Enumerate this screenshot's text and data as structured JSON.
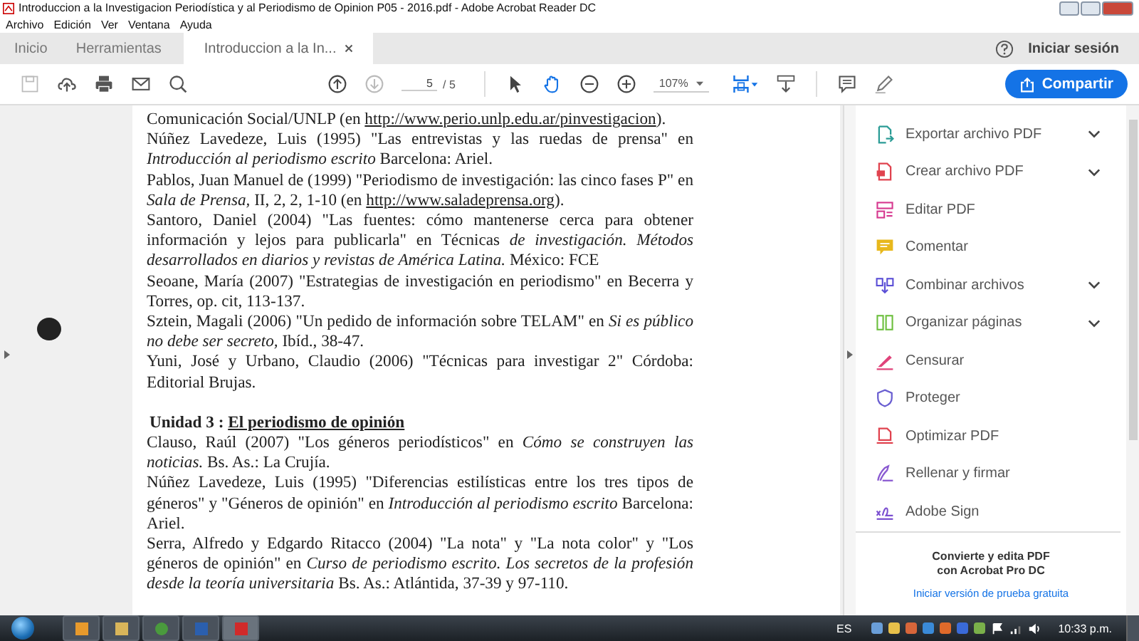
{
  "window": {
    "title": "Introduccion a la Investigacion Periodística y al Periodismo de Opinion P05 - 2016.pdf - Adobe Acrobat Reader DC"
  },
  "menu": [
    "Archivo",
    "Edición",
    "Ver",
    "Ventana",
    "Ayuda"
  ],
  "tabs": [
    {
      "label": "Inicio",
      "selected": false,
      "closable": false
    },
    {
      "label": "Herramientas",
      "selected": false,
      "closable": false
    },
    {
      "label": "Introduccion a la In...",
      "selected": true,
      "closable": true
    }
  ],
  "account": {
    "label": "Iniciar sesión"
  },
  "toolbar": {
    "page_current": "5",
    "page_total": "/ 5",
    "zoom": "107%",
    "share": "Compartir"
  },
  "document": {
    "references_top": [
      {
        "segments": [
          {
            "kind": "text",
            "text": "Comunicación Social/UNLP (en "
          },
          {
            "kind": "link",
            "text": "http://www.perio.unlp.edu.ar/pinvestigacion"
          },
          {
            "kind": "text",
            "text": ")."
          }
        ]
      },
      {
        "segments": [
          {
            "kind": "text",
            "text": "Núñez Lavedeze, Luis (1995) \"Las entrevistas y las ruedas de prensa\" en "
          },
          {
            "kind": "italic",
            "text": "Introducción al periodismo escrito"
          },
          {
            "kind": "text",
            "text": "  Barcelona: Ariel."
          }
        ]
      },
      {
        "segments": [
          {
            "kind": "text",
            "text": "Pablos, Juan Manuel de (1999) \"Periodismo de investigación: las cinco fases P\" en "
          },
          {
            "kind": "italic",
            "text": "Sala de Prensa,"
          },
          {
            "kind": "text",
            "text": " II, 2, 2, 1-10 (en "
          },
          {
            "kind": "link",
            "text": "http://www.saladeprensa.org"
          },
          {
            "kind": "text",
            "text": ")."
          }
        ]
      },
      {
        "segments": [
          {
            "kind": "text",
            "text": "Santoro, Daniel (2004) \"Las fuentes: cómo mantenerse cerca para obtener información y lejos para publicarla\" en Técnicas "
          },
          {
            "kind": "italic",
            "text": "de investigación. Métodos desarrollados en diarios y revistas de América Latina."
          },
          {
            "kind": "text",
            "text": " México: FCE"
          }
        ]
      },
      {
        "segments": [
          {
            "kind": "text",
            "text": "Seoane, María (2007) \"Estrategias de investigación en periodismo\" en Becerra y Torres, op. cit, 113-137."
          }
        ]
      },
      {
        "segments": [
          {
            "kind": "text",
            "text": "Sztein, Magali (2006) \"Un pedido de información sobre TELAM\" en "
          },
          {
            "kind": "italic",
            "text": "Si es público no debe ser secreto,"
          },
          {
            "kind": "text",
            "text": " Ibíd., 38-47."
          }
        ]
      },
      {
        "segments": [
          {
            "kind": "text",
            "text": "Yuni, José y Urbano, Claudio (2006) \"Técnicas para investigar 2\" Córdoba: Editorial Brujas."
          }
        ]
      }
    ],
    "heading": {
      "label": "Unidad 3 :",
      "title": "El periodismo de opinión"
    },
    "references_bottom": [
      {
        "segments": [
          {
            "kind": "text",
            "text": "Clauso, Raúl (2007) \"Los géneros periodísticos\" en "
          },
          {
            "kind": "italic",
            "text": "Cómo se construyen las noticias."
          },
          {
            "kind": "text",
            "text": " Bs. As.: La Crujía."
          }
        ]
      },
      {
        "segments": [
          {
            "kind": "text",
            "text": "Núñez Lavedeze, Luis (1995) \"Diferencias estilísticas entre los tres tipos de géneros\" y \"Géneros de opinión\" en "
          },
          {
            "kind": "italic",
            "text": "Introducción al periodismo escrito"
          },
          {
            "kind": "text",
            "text": "  Barcelona: Ariel."
          }
        ]
      },
      {
        "segments": [
          {
            "kind": "text",
            "text": "Serra, Alfredo y Edgardo Ritacco (2004) \"La nota\" y \"La nota color\" y \"Los géneros de opinión\" en  "
          },
          {
            "kind": "italic",
            "text": "Curso de periodismo escrito. Los secretos de la profesión desde la teoría universitaria"
          },
          {
            "kind": "text",
            "text": " Bs. As.: Atlántida, 37-39 y 97-110."
          }
        ]
      }
    ]
  },
  "tools": [
    {
      "kind": "export",
      "label": "Exportar archivo PDF",
      "expandable": true,
      "color": "#2b9c96"
    },
    {
      "kind": "create",
      "label": "Crear archivo PDF",
      "expandable": true,
      "color": "#e0434f"
    },
    {
      "kind": "edit",
      "label": "Editar PDF",
      "expandable": false,
      "color": "#d6388f"
    },
    {
      "kind": "comment",
      "label": "Comentar",
      "expandable": false,
      "color": "#e8b81c"
    },
    {
      "kind": "combine",
      "label": "Combinar archivos",
      "expandable": true,
      "color": "#5b4fd6"
    },
    {
      "kind": "organize",
      "label": "Organizar páginas",
      "expandable": true,
      "color": "#6cbf3d"
    },
    {
      "kind": "redact",
      "label": "Censurar",
      "expandable": false,
      "color": "#e0437a"
    },
    {
      "kind": "protect",
      "label": "Proteger",
      "expandable": false,
      "color": "#6a5fd1"
    },
    {
      "kind": "optimize",
      "label": "Optimizar PDF",
      "expandable": false,
      "color": "#e0434f"
    },
    {
      "kind": "fill-sign",
      "label": "Rellenar y firmar",
      "expandable": false,
      "color": "#8a5ad1"
    },
    {
      "kind": "adobe-sign",
      "label": "Adobe Sign",
      "expandable": false,
      "color": "#7b4fd0"
    }
  ],
  "promo": {
    "line1": "Convierte y edita PDF",
    "line2": "con Acrobat Pro DC",
    "link": "Iniciar versión de prueba gratuita"
  },
  "taskbar": {
    "language": "ES",
    "time": "10:33 p.m."
  }
}
